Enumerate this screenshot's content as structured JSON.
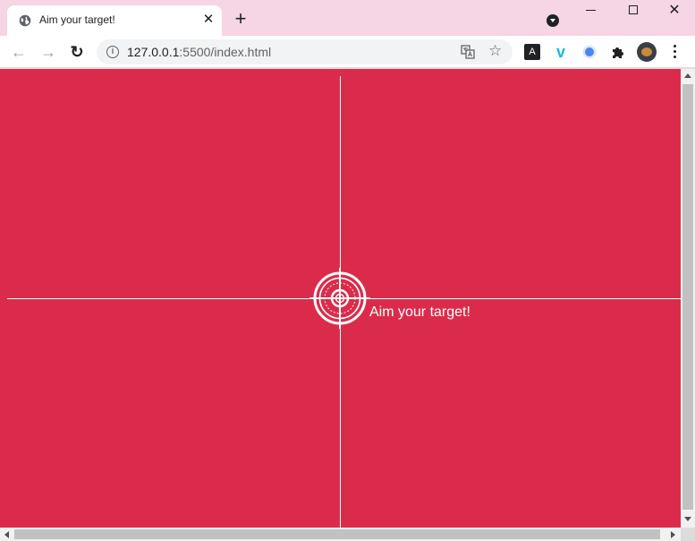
{
  "browser": {
    "tab": {
      "title": "Aim your target!",
      "favicon": "globe-icon",
      "close_glyph": "✕"
    },
    "new_tab_glyph": "+",
    "window_controls": {
      "close_glyph": "✕"
    },
    "toolbar": {
      "back_glyph": "←",
      "forward_glyph": "→",
      "reload_glyph": "↻",
      "info_glyph": "i",
      "url_host": "127.0.0.1",
      "url_rest": ":5500/index.html",
      "star_glyph": "☆",
      "extensions": [
        {
          "name": "a-extension-icon",
          "glyph": "A"
        },
        {
          "name": "vimeo-icon",
          "glyph": "v"
        },
        {
          "name": "circle-extension-icon"
        },
        {
          "name": "puzzle-icon"
        }
      ]
    }
  },
  "page": {
    "background_color": "#da2c4a",
    "foreground_color": "#ffffff",
    "caption": "Aim your target!"
  }
}
